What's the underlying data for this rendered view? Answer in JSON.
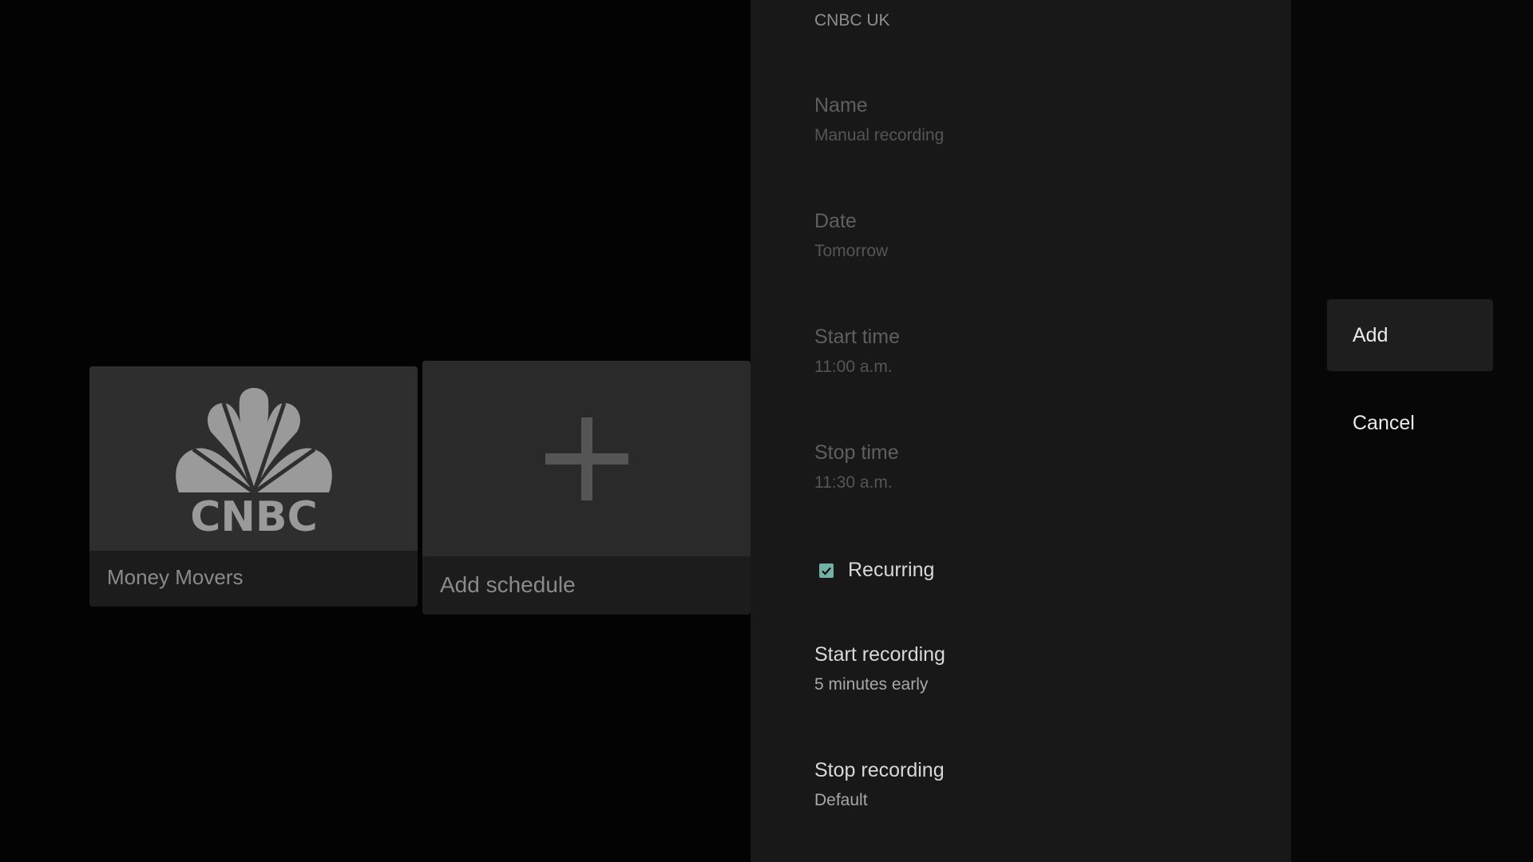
{
  "browse": {
    "channel_card": {
      "logo_text": "CNBC",
      "title": "Money Movers"
    },
    "add_card": {
      "title": "Add schedule"
    }
  },
  "panel": {
    "header": "CNBC UK",
    "fields": {
      "name": {
        "label": "Name",
        "value": "Manual recording"
      },
      "date": {
        "label": "Date",
        "value": "Tomorrow"
      },
      "start_time": {
        "label": "Start time",
        "value": "11:00 a.m."
      },
      "stop_time": {
        "label": "Stop time",
        "value": "11:30 a.m."
      },
      "start_recording": {
        "label": "Start recording",
        "value": "5 minutes early"
      },
      "stop_recording": {
        "label": "Stop recording",
        "value": "Default"
      }
    },
    "recurring": {
      "label": "Recurring",
      "checked": true
    }
  },
  "actions": {
    "add": "Add",
    "cancel": "Cancel"
  },
  "icons": {
    "logo": "peacock-logo-icon",
    "add": "plus-icon",
    "check": "checkmark-icon"
  },
  "colors": {
    "checkbox_accent": "#74b0a6"
  }
}
